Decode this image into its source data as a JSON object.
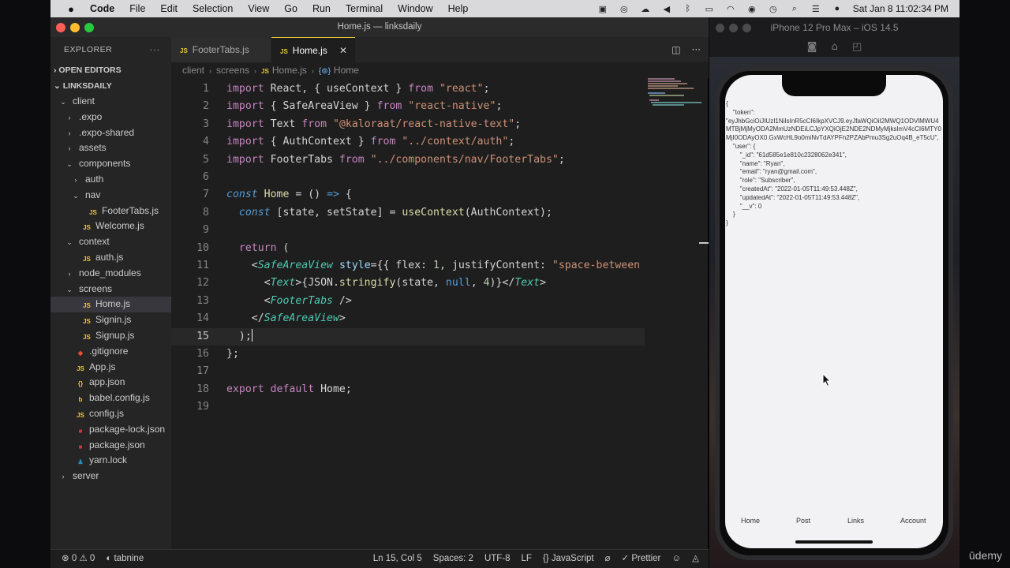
{
  "menubar": {
    "app": "Code",
    "items": [
      "File",
      "Edit",
      "Selection",
      "View",
      "Go",
      "Run",
      "Terminal",
      "Window",
      "Help"
    ],
    "datetime": "Sat Jan 8  11:02:34 PM"
  },
  "window": {
    "title": "Home.js — linksdaily"
  },
  "explorer": {
    "header": "EXPLORER",
    "more": "···",
    "open_editors": "OPEN EDITORS",
    "project": "LINKSDAILY",
    "tree": [
      {
        "label": "client",
        "type": "folder",
        "depth": 0,
        "open": true
      },
      {
        "label": ".expo",
        "type": "folder",
        "depth": 1
      },
      {
        "label": ".expo-shared",
        "type": "folder",
        "depth": 1
      },
      {
        "label": "assets",
        "type": "folder",
        "depth": 1
      },
      {
        "label": "components",
        "type": "folder",
        "depth": 1,
        "open": true
      },
      {
        "label": "auth",
        "type": "folder",
        "depth": 2
      },
      {
        "label": "nav",
        "type": "folder",
        "depth": 2,
        "open": true
      },
      {
        "label": "FooterTabs.js",
        "type": "js",
        "depth": 3
      },
      {
        "label": "Welcome.js",
        "type": "js",
        "depth": 2
      },
      {
        "label": "context",
        "type": "folder",
        "depth": 1,
        "open": true
      },
      {
        "label": "auth.js",
        "type": "js",
        "depth": 2
      },
      {
        "label": "node_modules",
        "type": "folder",
        "depth": 1
      },
      {
        "label": "screens",
        "type": "folder",
        "depth": 1,
        "open": true
      },
      {
        "label": "Home.js",
        "type": "js",
        "depth": 2,
        "selected": true
      },
      {
        "label": "Signin.js",
        "type": "js",
        "depth": 2
      },
      {
        "label": "Signup.js",
        "type": "js",
        "depth": 2
      },
      {
        "label": ".gitignore",
        "type": "git",
        "depth": 1
      },
      {
        "label": "App.js",
        "type": "js",
        "depth": 1
      },
      {
        "label": "app.json",
        "type": "json",
        "depth": 1
      },
      {
        "label": "babel.config.js",
        "type": "babel",
        "depth": 1
      },
      {
        "label": "config.js",
        "type": "js",
        "depth": 1
      },
      {
        "label": "package-lock.json",
        "type": "npm",
        "depth": 1
      },
      {
        "label": "package.json",
        "type": "npm",
        "depth": 1
      },
      {
        "label": "yarn.lock",
        "type": "yarn",
        "depth": 1
      },
      {
        "label": "server",
        "type": "folder",
        "depth": 0
      }
    ]
  },
  "tabs": [
    {
      "label": "FooterTabs.js",
      "active": false
    },
    {
      "label": "Home.js",
      "active": true
    }
  ],
  "breadcrumb": [
    "client",
    "screens",
    "Home.js",
    "Home"
  ],
  "editor": {
    "active_line": 15,
    "lines": [
      [
        [
          "k",
          "import"
        ],
        [
          "p",
          " React, { useContext } "
        ],
        [
          "k",
          "from"
        ],
        [
          "p",
          " "
        ],
        [
          "s",
          "\"react\""
        ],
        [
          "p",
          ";"
        ]
      ],
      [
        [
          "k",
          "import"
        ],
        [
          "p",
          " { SafeAreaView } "
        ],
        [
          "k",
          "from"
        ],
        [
          "p",
          " "
        ],
        [
          "s",
          "\"react-native\""
        ],
        [
          "p",
          ";"
        ]
      ],
      [
        [
          "k",
          "import"
        ],
        [
          "p",
          " Text "
        ],
        [
          "k",
          "from"
        ],
        [
          "p",
          " "
        ],
        [
          "s",
          "\"@kaloraat/react-native-text\""
        ],
        [
          "p",
          ";"
        ]
      ],
      [
        [
          "k",
          "import"
        ],
        [
          "p",
          " { AuthContext } "
        ],
        [
          "k",
          "from"
        ],
        [
          "p",
          " "
        ],
        [
          "s",
          "\"../context/auth\""
        ],
        [
          "p",
          ";"
        ]
      ],
      [
        [
          "k",
          "import"
        ],
        [
          "p",
          " FooterTabs "
        ],
        [
          "k",
          "from"
        ],
        [
          "p",
          " "
        ],
        [
          "s",
          "\"../components/nav/FooterTabs\""
        ],
        [
          "p",
          ";"
        ]
      ],
      [],
      [
        [
          "k2",
          "const"
        ],
        [
          "p",
          " "
        ],
        [
          "f",
          "Home"
        ],
        [
          "p",
          " = () "
        ],
        [
          "nl",
          "=>"
        ],
        [
          "p",
          " {"
        ]
      ],
      [
        [
          "p",
          "  "
        ],
        [
          "k2",
          "const"
        ],
        [
          "p",
          " [state, setState] = "
        ],
        [
          "f",
          "useContext"
        ],
        [
          "p",
          "(AuthContext);"
        ]
      ],
      [],
      [
        [
          "p",
          "  "
        ],
        [
          "k",
          "return"
        ],
        [
          "p",
          " ("
        ]
      ],
      [
        [
          "p",
          "    <"
        ],
        [
          "t",
          "SafeAreaView"
        ],
        [
          "p",
          " "
        ],
        [
          "a",
          "style"
        ],
        [
          "p",
          "={{ flex: "
        ],
        [
          "n",
          "1"
        ],
        [
          "p",
          ", justifyContent: "
        ],
        [
          "s",
          "\"space-between"
        ]
      ],
      [
        [
          "p",
          "      <"
        ],
        [
          "t",
          "Text"
        ],
        [
          "p",
          ">{JSON."
        ],
        [
          "f",
          "stringify"
        ],
        [
          "p",
          "(state, "
        ],
        [
          "nl",
          "null"
        ],
        [
          "p",
          ", "
        ],
        [
          "n",
          "4"
        ],
        [
          "p",
          ")}</"
        ],
        [
          "t",
          "Text"
        ],
        [
          "p",
          ">"
        ]
      ],
      [
        [
          "p",
          "      <"
        ],
        [
          "t",
          "FooterTabs"
        ],
        [
          "p",
          " />"
        ]
      ],
      [
        [
          "p",
          "    </"
        ],
        [
          "t",
          "SafeAreaView"
        ],
        [
          "p",
          ">"
        ]
      ],
      [
        [
          "p",
          "  );"
        ]
      ],
      [
        [
          "p",
          "};"
        ]
      ],
      [],
      [
        [
          "k",
          "export"
        ],
        [
          "p",
          " "
        ],
        [
          "k",
          "default"
        ],
        [
          "p",
          " Home;"
        ]
      ],
      []
    ]
  },
  "statusbar": {
    "problems": "⊗ 0 ⚠ 0",
    "tabnine": "tabnine",
    "position": "Ln 15, Col 5",
    "spaces": "Spaces: 2",
    "encoding": "UTF-8",
    "eol": "LF",
    "language": "JavaScript",
    "prettier": "Prettier"
  },
  "simulator": {
    "title": "iPhone 12 Pro Max – iOS 14.5",
    "state_text": "{\n    \"token\":\n\"eyJhbGciOiJIUzI1NiIsInR5cCI6IkpXVCJ9.eyJfaWQiOiI2MWQ1ODVlMWU4MTBjMjMyODA2MmUzNDEiLCJpYXQiOjE2NDE2NDMyMjksImV4cCI6MTY0MjI0ODAyOX0.GxWcHL9o0miNvTdAYPFn2PZAbPmu3Sg2uOq4B_eT5cU\",\n    \"user\": {\n        \"_id\": \"61d585e1e810c2328062e341\",\n        \"name\": \"Ryan\",\n        \"email\": \"ryan@gmail.com\",\n        \"role\": \"Subscriber\",\n        \"createdAt\": \"2022-01-05T11:49:53.448Z\",\n        \"updatedAt\": \"2022-01-05T11:49:53.448Z\",\n        \"__v\": 0\n    }\n}",
    "footer_tabs": [
      "Home",
      "Post",
      "Links",
      "Account"
    ]
  },
  "watermark": "ūdemy"
}
